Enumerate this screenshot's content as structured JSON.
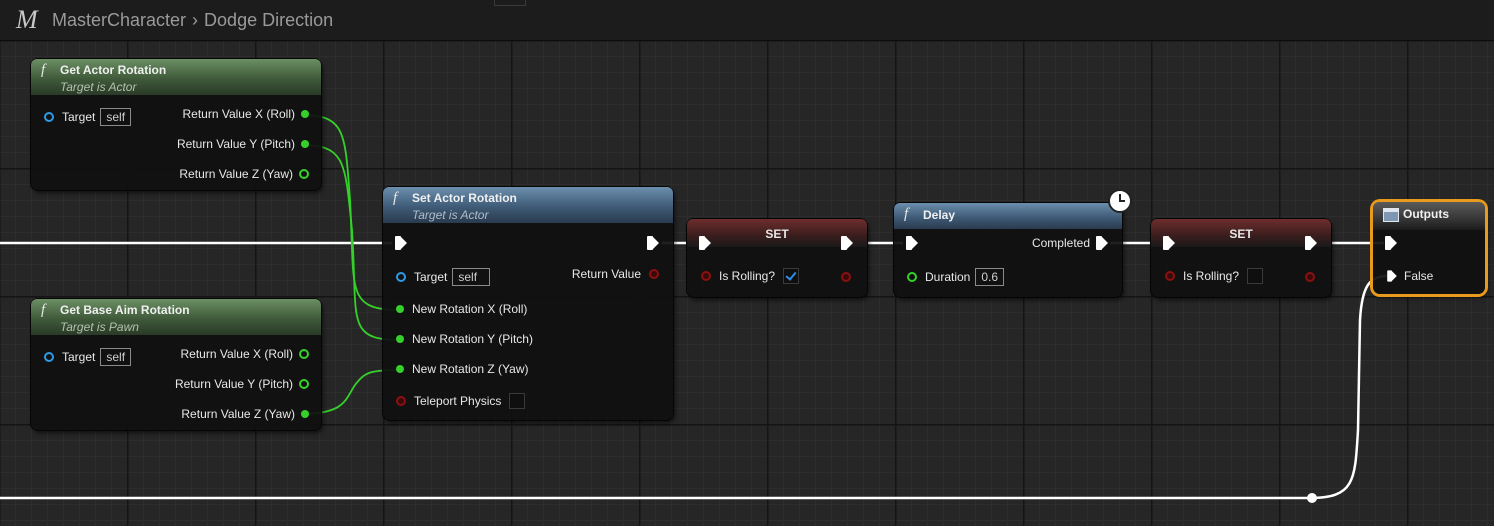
{
  "breadcrumb": {
    "logo": "M",
    "blueprint": "MasterCharacter",
    "separator": "›",
    "function": "Dodge Direction"
  },
  "nodes": {
    "get_actor_rotation": {
      "title": "Get Actor Rotation",
      "subtitle": "Target is Actor",
      "target_label": "Target",
      "target_value": "self",
      "outputs": [
        "Return Value X (Roll)",
        "Return Value Y (Pitch)",
        "Return Value Z (Yaw)"
      ]
    },
    "get_base_aim_rotation": {
      "title": "Get Base Aim Rotation",
      "subtitle": "Target is Pawn",
      "target_label": "Target",
      "target_value": "self",
      "outputs": [
        "Return Value X (Roll)",
        "Return Value Y (Pitch)",
        "Return Value Z (Yaw)"
      ]
    },
    "set_actor_rotation": {
      "title": "Set Actor Rotation",
      "subtitle": "Target is Actor",
      "target_label": "Target",
      "target_value": "self",
      "return_value": "Return Value",
      "inputs": [
        "New Rotation X (Roll)",
        "New Rotation Y (Pitch)",
        "New Rotation Z (Yaw)",
        "Teleport Physics"
      ],
      "teleport_physics": false
    },
    "set_rolling_true": {
      "title": "SET",
      "var_label": "Is Rolling?",
      "checked": true
    },
    "delay": {
      "title": "Delay",
      "completed_label": "Completed",
      "duration_label": "Duration",
      "duration_value": "0.6"
    },
    "set_rolling_false": {
      "title": "SET",
      "var_label": "Is Rolling?",
      "checked": false
    },
    "outputs": {
      "title": "Outputs",
      "return_label": "False"
    }
  },
  "colors": {
    "exec": "#ffffff",
    "float_pin": "#35d12a",
    "struct_object": "#2e9ae8",
    "bool_pin": "#a01414",
    "selection": "#e79a1c",
    "header_pure": "#3f5a3a",
    "header_func": "#3f5b77",
    "header_set": "#6e2d2d"
  },
  "icons": {
    "function": "f-function-icon",
    "delay": "clock-icon",
    "outputs": "window-icon"
  }
}
